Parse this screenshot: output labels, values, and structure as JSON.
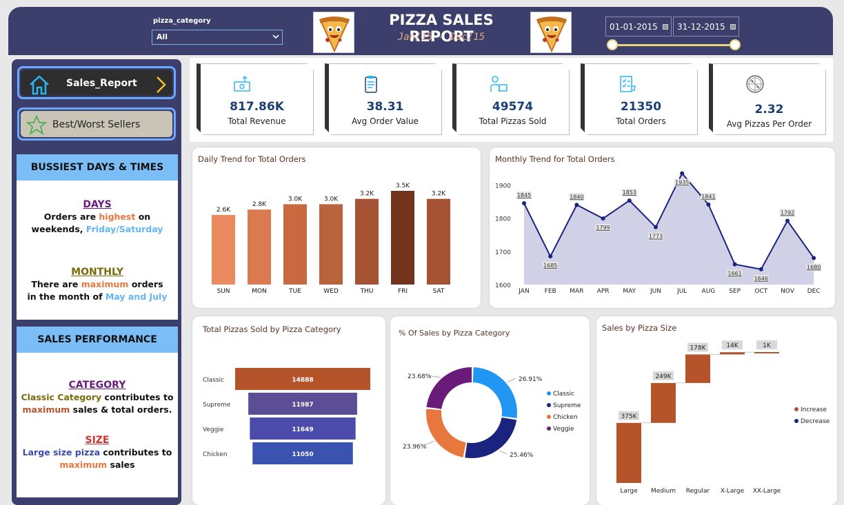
{
  "header": {
    "filter_label": "pizza_category",
    "filter_value": "All",
    "title": "PIZZA SALES REPORT",
    "subtitle": "Jan/15 - Dec/15",
    "date_start": "01-01-2015",
    "date_end": "31-12-2015"
  },
  "nav": {
    "sales_report": "Sales_Report",
    "best_worst": "Best/Worst Sellers"
  },
  "busiest": {
    "heading": "BUSSIEST DAYS & TIMES",
    "days_title": "DAYS",
    "days_line1_a": "Orders are ",
    "days_line1_b": "highest",
    "days_line1_c": " on",
    "days_line2_a": "weekends, ",
    "days_line2_b": "Friday/Saturday",
    "monthly_title": "MONTHLY",
    "monthly_line1_a": "There are ",
    "monthly_line1_b": "maximum",
    "monthly_line1_c": " orders",
    "monthly_line2_a": "in the month of ",
    "monthly_line2_b": "May and July"
  },
  "performance": {
    "heading": "SALES PERFORMANCE",
    "category_title": "CATEGORY",
    "cat_line1_a": "Classic Category",
    "cat_line1_b": " contributes to",
    "cat_line2_a": "maximum",
    "cat_line2_b": " sales & total orders.",
    "size_title": "SIZE",
    "size_line1_a": "Large size pizza",
    "size_line1_b": " contributes to",
    "size_line2_a": "maximum",
    "size_line2_b": " sales"
  },
  "kpis": [
    {
      "value": "817.86K",
      "label": "Total Revenue",
      "icon": "money-icon"
    },
    {
      "value": "38.31",
      "label": "Avg Order Value",
      "icon": "clipboard-icon"
    },
    {
      "value": "49574",
      "label": "Total Pizzas Sold",
      "icon": "delivery-icon"
    },
    {
      "value": "21350",
      "label": "Total Orders",
      "icon": "checklist-icon"
    },
    {
      "value": "2.32",
      "label": "Avg Pizzas Per Order",
      "icon": "pizza-icon"
    }
  ],
  "colors": {
    "header_bg": "#3c3f6b",
    "accent_blue": "#7bbdf7",
    "orange": "#e88a55",
    "brown": "#a85530",
    "navy": "#1a237e"
  },
  "chart_data": [
    {
      "type": "bar",
      "title": "Daily Trend for Total Orders",
      "categories": [
        "SUN",
        "MON",
        "TUE",
        "WED",
        "THU",
        "FRI",
        "SAT"
      ],
      "values": [
        2.6,
        2.8,
        3.0,
        3.0,
        3.2,
        3.5,
        3.2
      ],
      "labels": [
        "2.6K",
        "2.8K",
        "3.0K",
        "3.0K",
        "3.2K",
        "3.5K",
        "3.2K"
      ],
      "colors": [
        "#ea8a5e",
        "#da7a50",
        "#c8693f",
        "#b9623c",
        "#a45232",
        "#74331d",
        "#a45232"
      ]
    },
    {
      "type": "area",
      "title": "Monthly Trend for Total Orders",
      "categories": [
        "JAN",
        "FEB",
        "MAR",
        "APR",
        "MAY",
        "JUN",
        "JUL",
        "AUG",
        "SEP",
        "OCT",
        "NOV",
        "DEC"
      ],
      "values": [
        1845,
        1685,
        1840,
        1799,
        1853,
        1773,
        1935,
        1841,
        1661,
        1646,
        1792,
        1680
      ],
      "yticks": [
        "1900",
        "1800",
        "1700",
        "1600"
      ],
      "ylim": [
        1600,
        1930
      ]
    },
    {
      "type": "bar",
      "title": "Total Pizzas Sold by Pizza Category",
      "categories": [
        "Classic",
        "Supreme",
        "Veggie",
        "Chicken"
      ],
      "values": [
        14888,
        11987,
        11649,
        11050
      ],
      "colors": [
        "#b5532b",
        "#5b4d96",
        "#4a4bab",
        "#3a52b0"
      ]
    },
    {
      "type": "pie",
      "title": "% Of Sales by Pizza Category",
      "categories": [
        "Classic",
        "Supreme",
        "Chicken",
        "Veggie"
      ],
      "values": [
        26.91,
        25.46,
        23.96,
        23.68
      ],
      "labels": [
        "26.91%",
        "25.46%",
        "23.96%",
        "23.68%"
      ],
      "colors": [
        "#2196f3",
        "#1a237e",
        "#e8773e",
        "#6a1b7a"
      ]
    },
    {
      "type": "bar",
      "title": "Sales by Pizza Size",
      "categories": [
        "Large",
        "Medium",
        "Regular",
        "X-Large",
        "XX-Large"
      ],
      "values": [
        375,
        249,
        178,
        14,
        1
      ],
      "labels": [
        "375K",
        "249K",
        "178K",
        "14K",
        "1K"
      ],
      "legend": [
        "Increase",
        "Decrease"
      ]
    }
  ]
}
